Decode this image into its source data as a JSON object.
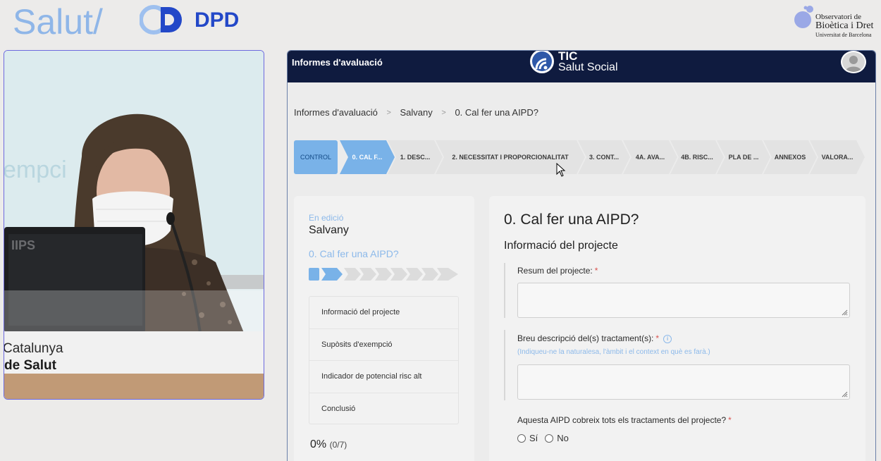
{
  "header": {
    "salut_brand": "Salut/",
    "dpd_brand": "DPD",
    "observatory": {
      "line1": "Observatori de",
      "line2": "Bioètica i Dret",
      "line3": "Universitat de Barcelona"
    }
  },
  "video": {
    "sign_line1": "Catalunya",
    "sign_line2": "de Salut"
  },
  "app": {
    "navbar": {
      "title": "Informes d'avaluació",
      "logo_line1": "TIC",
      "logo_line2": "Salut Social",
      "avatar_icon": "user-icon"
    },
    "breadcrumb": [
      "Informes d'avaluació",
      "Salvany",
      "0. Cal fer una AIPD?"
    ],
    "steps": [
      {
        "label": "CONTROL",
        "state": "active"
      },
      {
        "label": "0. CAL F...",
        "state": "active"
      },
      {
        "label": "1. DESC...",
        "state": "idle"
      },
      {
        "label": "2. NECESSITAT I PROPORCIONALITAT",
        "state": "idle"
      },
      {
        "label": "3. CONT...",
        "state": "idle"
      },
      {
        "label": "4A. AVA...",
        "state": "idle"
      },
      {
        "label": "4B. RISC...",
        "state": "idle"
      },
      {
        "label": "PLA DE ...",
        "state": "idle"
      },
      {
        "label": "ANNEXOS",
        "state": "idle"
      },
      {
        "label": "VALORA...",
        "state": "idle"
      }
    ],
    "left": {
      "status": "En edició",
      "project": "Salvany",
      "section": "0. Cal fer una AIPD?",
      "menu": [
        "Informació del projecte",
        "Supòsits d'exempció",
        "Indicador de potencial risc alt",
        "Conclusió"
      ],
      "percent": "0%",
      "percent_detail": "(0/7)",
      "progress_fraction": 0
    },
    "right": {
      "title": "0. Cal fer una AIPD?",
      "subtitle": "Informació del projecte",
      "field1_label": "Resum del projecte:",
      "field1_value": "",
      "field2_label": "Breu descripció del(s) tractament(s):",
      "field2_hint": "(Indiqueu-ne la naturalesa, l'àmbit i el context en què es farà.)",
      "field2_value": "",
      "question": "Aquesta AIPD cobreix tots els tractaments del projecte?",
      "required_mark": "*",
      "option_yes": "Sí",
      "option_no": "No"
    }
  },
  "colors": {
    "navy": "#0f1b3f",
    "accent_blue": "#79b2e8",
    "hint_blue": "#8cb9ea",
    "required_red": "#d9534f"
  }
}
